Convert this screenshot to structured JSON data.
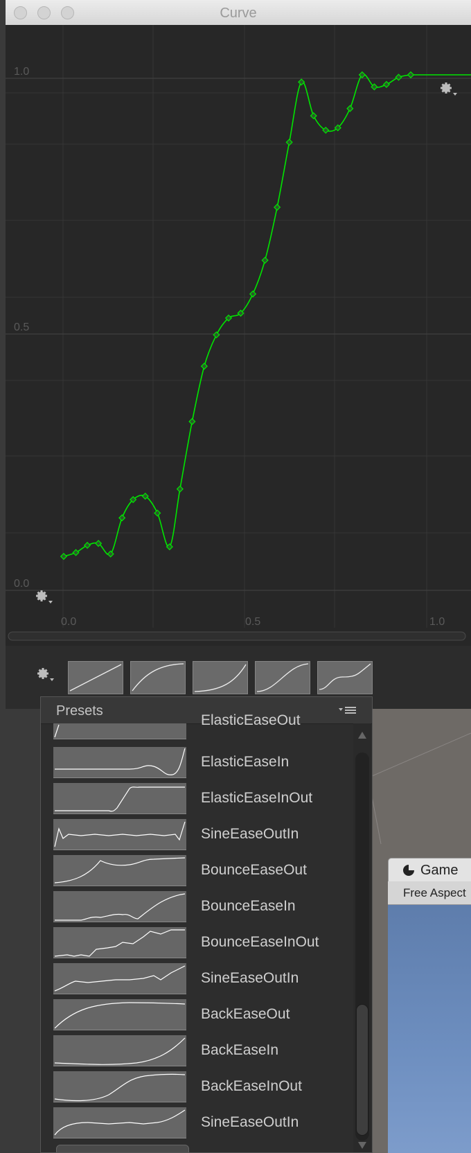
{
  "window": {
    "title": "Curve"
  },
  "graph": {
    "y_labels": [
      "1.0",
      "0.5",
      "0.0"
    ],
    "x_labels": [
      "0.0",
      "0.5",
      "1.0"
    ],
    "curve_color": "#00e600",
    "keyframes": [
      [
        0.0,
        0.0
      ],
      [
        0.035,
        0.008
      ],
      [
        0.068,
        0.023
      ],
      [
        0.1,
        0.027
      ],
      [
        0.135,
        0.005
      ],
      [
        0.168,
        0.08
      ],
      [
        0.2,
        0.118
      ],
      [
        0.235,
        0.125
      ],
      [
        0.27,
        0.09
      ],
      [
        0.305,
        0.02
      ],
      [
        0.335,
        0.14
      ],
      [
        0.37,
        0.28
      ],
      [
        0.405,
        0.395
      ],
      [
        0.44,
        0.46
      ],
      [
        0.475,
        0.495
      ],
      [
        0.51,
        0.505
      ],
      [
        0.545,
        0.545
      ],
      [
        0.58,
        0.615
      ],
      [
        0.615,
        0.725
      ],
      [
        0.65,
        0.86
      ],
      [
        0.685,
        0.985
      ],
      [
        0.72,
        0.915
      ],
      [
        0.755,
        0.885
      ],
      [
        0.79,
        0.89
      ],
      [
        0.825,
        0.93
      ],
      [
        0.86,
        1.0
      ],
      [
        0.895,
        0.975
      ],
      [
        0.93,
        0.98
      ],
      [
        0.965,
        0.995
      ],
      [
        1.0,
        1.0
      ]
    ]
  },
  "presets": {
    "title": "Presets",
    "items": [
      {
        "label": "ElasticEaseOut"
      },
      {
        "label": "ElasticEaseIn"
      },
      {
        "label": "ElasticEaseInOut"
      },
      {
        "label": "SineEaseOutIn"
      },
      {
        "label": "BounceEaseOut"
      },
      {
        "label": "BounceEaseIn"
      },
      {
        "label": "BounceEaseInOut"
      },
      {
        "label": "SineEaseOutIn"
      },
      {
        "label": "BackEaseOut"
      },
      {
        "label": "BackEaseIn"
      },
      {
        "label": "BackEaseInOut"
      },
      {
        "label": "SineEaseOutIn"
      }
    ]
  },
  "game": {
    "tab_label": "Game",
    "aspect": "Free Aspect"
  }
}
